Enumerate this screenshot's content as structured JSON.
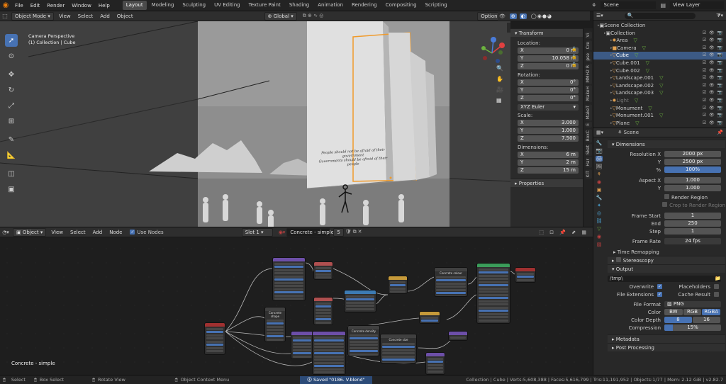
{
  "menu": [
    "File",
    "Edit",
    "Render",
    "Window",
    "Help"
  ],
  "workspaces": [
    "Layout",
    "Modeling",
    "Sculpting",
    "UV Editing",
    "Texture Paint",
    "Shading",
    "Animation",
    "Rendering",
    "Compositing",
    "Scripting"
  ],
  "active_workspace": "Layout",
  "scene_name": "Scene",
  "view_layer": "View Layer",
  "viewport": {
    "mode": "Object Mode",
    "menu": [
      "View",
      "Select",
      "Add",
      "Object"
    ],
    "orientation": "Global",
    "options": "Options",
    "info_line1": "Camera Perspective",
    "info_line2": "(1) Collection | Cube",
    "quote_line1": "People should not be afraid of their government",
    "quote_line2": "Governments should be afraid of their people"
  },
  "npanel": {
    "transform_title": "Transform",
    "location_label": "Location:",
    "location": [
      {
        "axis": "X",
        "value": "0 m"
      },
      {
        "axis": "Y",
        "value": "10.058 m"
      },
      {
        "axis": "Z",
        "value": "0 m"
      }
    ],
    "rotation_label": "Rotation:",
    "rotation": [
      {
        "axis": "X",
        "value": "0°"
      },
      {
        "axis": "Y",
        "value": "0°"
      },
      {
        "axis": "Z",
        "value": "0°"
      }
    ],
    "rotation_mode": "XYZ Euler",
    "scale_label": "Scale:",
    "scale": [
      {
        "axis": "X",
        "value": "3.000"
      },
      {
        "axis": "Y",
        "value": "1.000"
      },
      {
        "axis": "Z",
        "value": "7.500"
      }
    ],
    "dimensions_label": "Dimensions:",
    "dimensions": [
      {
        "axis": "X",
        "value": "6 m"
      },
      {
        "axis": "Y",
        "value": "2 m"
      },
      {
        "axis": "Z",
        "value": "15 m"
      }
    ],
    "properties_title": "Properties",
    "tabs": [
      "Vi",
      "Cre",
      "pse",
      "MMH2 R",
      "MakeH",
      "MakeT",
      "E",
      "BoxC",
      "Sket",
      "Har",
      "KIT"
    ]
  },
  "outliner": {
    "items": [
      {
        "name": "Scene Collection",
        "indent": 0,
        "icon": "▣",
        "color": "#ccc"
      },
      {
        "name": "Collection",
        "indent": 1,
        "icon": "▣",
        "color": "#ccc"
      },
      {
        "name": "Area",
        "indent": 2,
        "icon": "✹",
        "color": "#e0a050"
      },
      {
        "name": "Camera",
        "indent": 2,
        "icon": "■",
        "color": "#e0a050"
      },
      {
        "name": "Cube",
        "indent": 2,
        "icon": "▽",
        "color": "#e0a050",
        "selected": true
      },
      {
        "name": "Cube.001",
        "indent": 2,
        "icon": "▽",
        "color": "#e0a050"
      },
      {
        "name": "Cube.002",
        "indent": 2,
        "icon": "▽",
        "color": "#e0a050"
      },
      {
        "name": "Landscape.001",
        "indent": 2,
        "icon": "▽",
        "color": "#e0a050"
      },
      {
        "name": "Landscape.002",
        "indent": 2,
        "icon": "▽",
        "color": "#e0a050"
      },
      {
        "name": "Landscape.003",
        "indent": 2,
        "icon": "▽",
        "color": "#e0a050"
      },
      {
        "name": "Light",
        "indent": 2,
        "icon": "✹",
        "color": "#e0a050",
        "dim": true
      },
      {
        "name": "Monument",
        "indent": 2,
        "icon": "▽",
        "color": "#e0a050"
      },
      {
        "name": "Monument.001",
        "indent": 2,
        "icon": "▽",
        "color": "#e0a050"
      },
      {
        "name": "Plane",
        "indent": 2,
        "icon": "▽",
        "color": "#e0a050"
      }
    ]
  },
  "properties": {
    "scene": "Scene",
    "dimensions_title": "Dimensions",
    "resolution_x_label": "Resolution X",
    "resolution_x": "2000 px",
    "resolution_y_label": "Y",
    "resolution_y": "2500 px",
    "percent_label": "%",
    "percent": "100%",
    "aspect_x_label": "Aspect X",
    "aspect_x": "1.000",
    "aspect_y_label": "Y",
    "aspect_y": "1.000",
    "render_region": "Render Region",
    "crop_region": "Crop to Render Region",
    "frame_start_label": "Frame Start",
    "frame_start": "1",
    "frame_end_label": "End",
    "frame_end": "250",
    "step_label": "Step",
    "step": "1",
    "frame_rate_label": "Frame Rate",
    "frame_rate": "24 fps",
    "time_remapping": "Time Remapping",
    "stereoscopy": "Stereoscopy",
    "output_title": "Output",
    "output_path": "/tmp\\",
    "overwrite": "Overwrite",
    "placeholders": "Placeholders",
    "file_extensions": "File Extensions",
    "cache_result": "Cache Result",
    "file_format_label": "File Format",
    "file_format": "PNG",
    "color_label": "Color",
    "color_options": [
      "BW",
      "RGB",
      "RGBA"
    ],
    "color_depth_label": "Color Depth",
    "color_depth_options": [
      "8",
      "16"
    ],
    "compression_label": "Compression",
    "compression": "15%",
    "compression_fraction": 0.15,
    "metadata": "Metadata",
    "post_processing": "Post Processing"
  },
  "node_editor": {
    "type": "Object",
    "menu": [
      "View",
      "Select",
      "Add",
      "Node"
    ],
    "use_nodes": "Use Nodes",
    "slot": "Slot 1",
    "material": "Concrete - simple",
    "users": "5",
    "material_label": "Concrete - simple",
    "node_titles": [
      "Concrete shape",
      "Concrete colour",
      "Concrete density",
      "Concrete size"
    ]
  },
  "status": {
    "select": "Select",
    "box_select": "Box Select",
    "rotate_view": "Rotate View",
    "context_menu": "Object Context Menu",
    "saved": "Saved \"0186. V.blend\"",
    "stats": "Collection | Cube | Verts:5,608,388 | Faces:5,616,799 | Tris:11,191,952 | Objects:1/77 | Mem: 2.12 GiB | v2.82.7"
  },
  "colors": {
    "accent_blue": "#4772b3",
    "selection_orange": "#f09a2a",
    "outliner_selected": "#3c5a85"
  }
}
